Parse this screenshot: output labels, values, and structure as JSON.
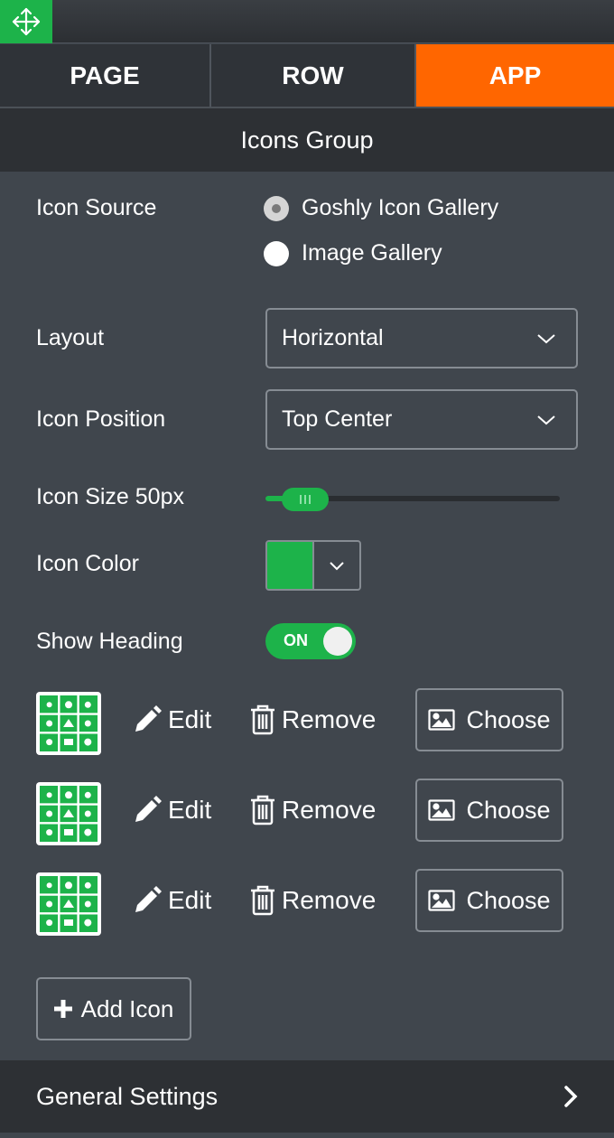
{
  "tabs": [
    {
      "label": "PAGE",
      "active": false
    },
    {
      "label": "ROW",
      "active": false
    },
    {
      "label": "APP",
      "active": true
    }
  ],
  "section_title": "Icons Group",
  "icon_source": {
    "label": "Icon Source",
    "options": [
      {
        "label": "Goshly Icon Gallery",
        "selected": true
      },
      {
        "label": "Image Gallery",
        "selected": false
      }
    ]
  },
  "layout": {
    "label": "Layout",
    "value": "Horizontal"
  },
  "icon_position": {
    "label": "Icon Position",
    "value": "Top Center"
  },
  "icon_size": {
    "label": "Icon Size 50px",
    "value": 50
  },
  "icon_color": {
    "label": "Icon Color",
    "color": "#1db34a"
  },
  "show_heading": {
    "label": "Show Heading",
    "state": "ON"
  },
  "icon_rows": [
    {
      "edit_label": "Edit",
      "remove_label": "Remove",
      "choose_label": "Choose"
    },
    {
      "edit_label": "Edit",
      "remove_label": "Remove",
      "choose_label": "Choose"
    },
    {
      "edit_label": "Edit",
      "remove_label": "Remove",
      "choose_label": "Choose"
    }
  ],
  "add_icon_label": "Add Icon",
  "footer": {
    "label": "General Settings"
  },
  "colors": {
    "accent": "#ff6600",
    "green": "#1db34a",
    "panel": "#40464d"
  }
}
